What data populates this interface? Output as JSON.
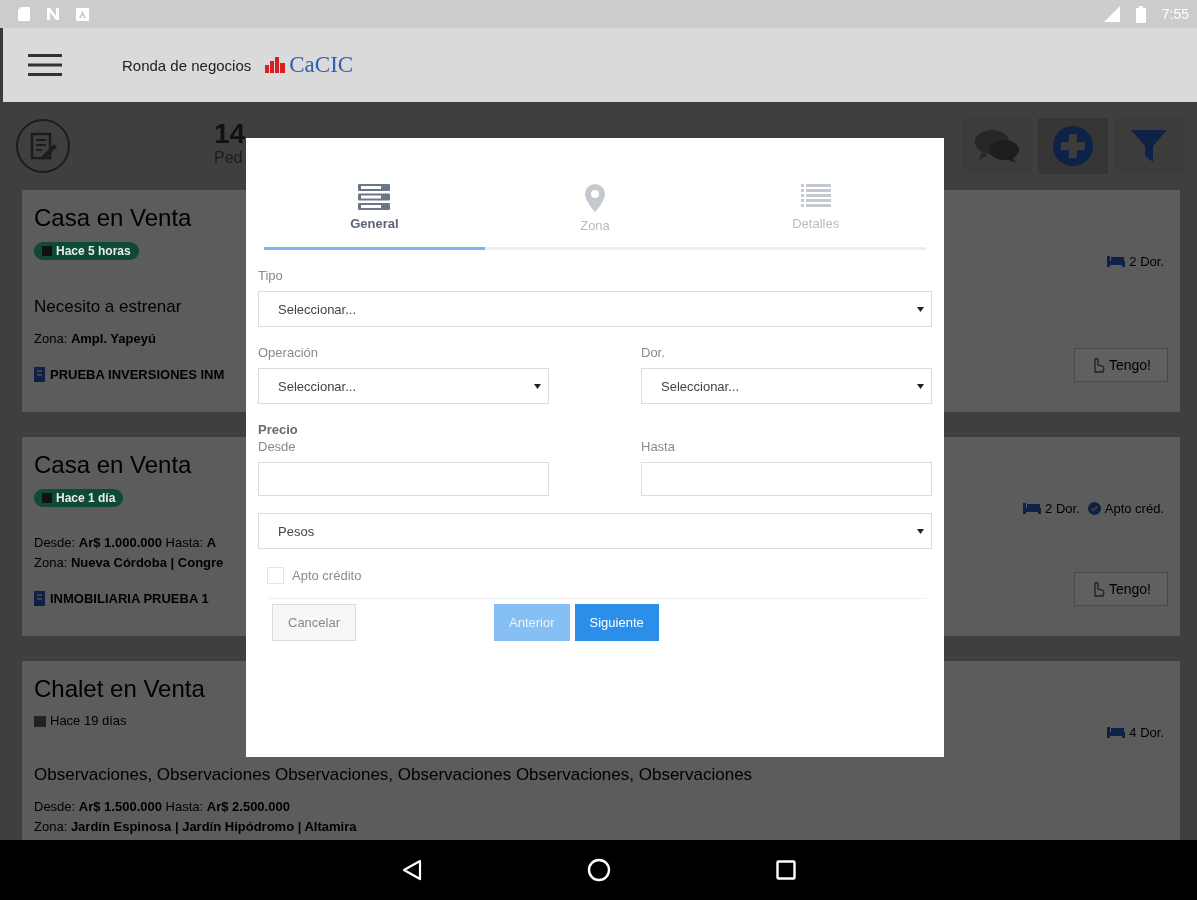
{
  "status_bar": {
    "time": "7:55"
  },
  "app_bar": {
    "title": "Ronda de negocios",
    "logo": "CaCIC"
  },
  "summary": {
    "count": "14",
    "label": "Ped"
  },
  "toolbar": [
    {
      "kind": "chat"
    },
    {
      "kind": "add"
    },
    {
      "kind": "filter"
    }
  ],
  "cards": [
    {
      "title": "Casa en Venta",
      "time": {
        "text": "Hace 5 horas",
        "highlighted": true
      },
      "description": "Necesito a estrenar",
      "lines": [
        {
          "parts": [
            {
              "label": "Zona:",
              "value": "Ampl. Yapeyú"
            }
          ]
        }
      ],
      "agency": "PRUEBA INVERSIONES INM",
      "features": [
        {
          "kind": "bed",
          "text": "2 Dor."
        }
      ],
      "button": "Tengo!"
    },
    {
      "title": "Casa en Venta",
      "time": {
        "text": "Hace 1 día",
        "highlighted": true
      },
      "lines": [
        {
          "parts": [
            {
              "label": "Desde:",
              "value": "Ar$ 1.000.000"
            },
            {
              "label": "Hasta:",
              "value": "A"
            }
          ]
        },
        {
          "parts": [
            {
              "label": "Zona:",
              "value": "Nueva Córdoba | Congre"
            }
          ]
        }
      ],
      "agency": "INMOBILIARIA PRUEBA 1",
      "features": [
        {
          "kind": "bed",
          "text": "2 Dor."
        },
        {
          "kind": "check",
          "text": "Apto créd."
        }
      ],
      "button": "Tengo!"
    },
    {
      "title": "Chalet en Venta",
      "time": {
        "text": "Hace 19 días",
        "highlighted": false
      },
      "description": "Observaciones, Observaciones Observaciones, Observaciones Observaciones, Observaciones",
      "lines": [
        {
          "parts": [
            {
              "label": "Desde:",
              "value": "Ar$ 1.500.000"
            },
            {
              "label": "Hasta:",
              "value": "Ar$ 2.500.000"
            }
          ]
        },
        {
          "parts": [
            {
              "label": "Zona:",
              "value": "Jardín Espinosa | Jardín Hipódromo | Altamira"
            }
          ]
        }
      ],
      "features": [
        {
          "kind": "bed",
          "text": "4 Dor."
        }
      ]
    }
  ],
  "dialog": {
    "tabs": [
      {
        "label": "General",
        "kind": "general",
        "selected": true
      },
      {
        "label": "Zona",
        "kind": "zona",
        "selected": false
      },
      {
        "label": "Detalles",
        "kind": "detalles",
        "selected": false
      }
    ],
    "tipo": {
      "label": "Tipo",
      "value": "Seleccionar..."
    },
    "operacion": {
      "label": "Operación",
      "value": "Seleccionar..."
    },
    "dor": {
      "label": "Dor.",
      "value": "Seleccionar..."
    },
    "precio": {
      "title": "Precio",
      "desde": {
        "label": "Desde"
      },
      "hasta": {
        "label": "Hasta"
      },
      "moneda": "Pesos"
    },
    "apto_credito": {
      "label": "Apto crédito",
      "checked": false
    },
    "buttons": [
      {
        "label": "Cancelar",
        "kind": "secondary",
        "disabled": false
      },
      {
        "label": "Anterior",
        "kind": "primary",
        "disabled": true
      },
      {
        "label": "Siguiente",
        "kind": "primary",
        "disabled": false
      }
    ]
  }
}
